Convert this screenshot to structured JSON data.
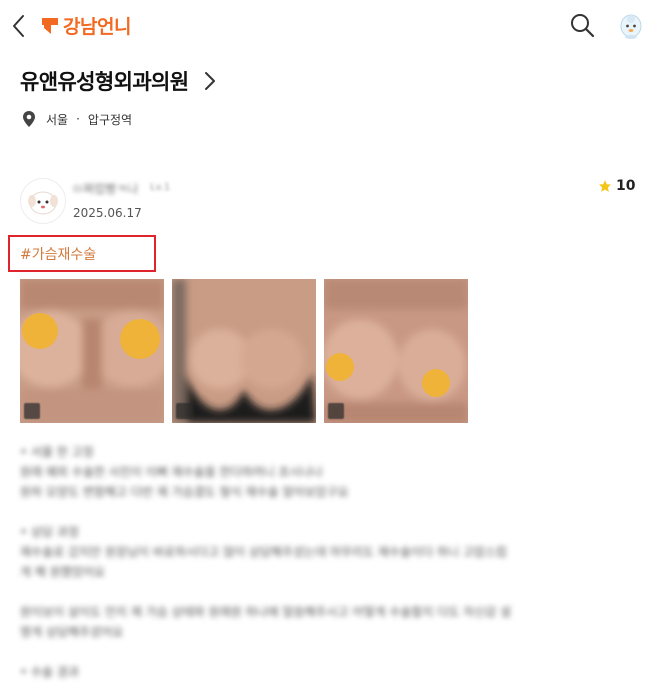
{
  "header": {
    "logo_text": "강남언니",
    "brand_color": "#f26a22",
    "icons": [
      "chevron-left-icon",
      "logo-mark-icon",
      "search-icon",
      "profile-avatar-icon"
    ]
  },
  "clinic": {
    "name": "유앤유성형외과의원",
    "location_city": "서울",
    "location_separator": "·",
    "location_area": "압구정역"
  },
  "review": {
    "author_name": "ㅁ쩌럽빵ㅋ나",
    "author_level": "Lv.1",
    "date": "2025.06.17",
    "rating": "10",
    "star_color": "#f5c518",
    "tag": "#가슴재수술",
    "highlight_color": "#e0242b",
    "photos": [
      {
        "label": "before photo 1",
        "badge": "1"
      },
      {
        "label": "before photo 2",
        "badge": "2"
      },
      {
        "label": "before photo 3",
        "badge": "3"
      }
    ],
    "body_lines": [
      "• 서울 한 고정",
      "원래 예외 수술한 사진이 이뻐 재수술을 한다하려니 흐시나나",
      "원하 모양도 변함해고 다반 재 가슴결도 형식 재수술 알아보았구요",
      "",
      "• 상담 과정",
      "재수술로 갔지만 원장님이 바로하시다고 많이 상담해주셨는데 마무리도 재수술이다 하니 고맙스럽",
      "게 해 원했었어요",
      "",
      "원이보이 살이도 안지 재 가슴 상태와 원래원 하나에 말씀해주시고 어떻게 수술할지 다도 자신감 설",
      "명게 상담해주셨어요",
      "",
      "• 수술 경과"
    ]
  }
}
